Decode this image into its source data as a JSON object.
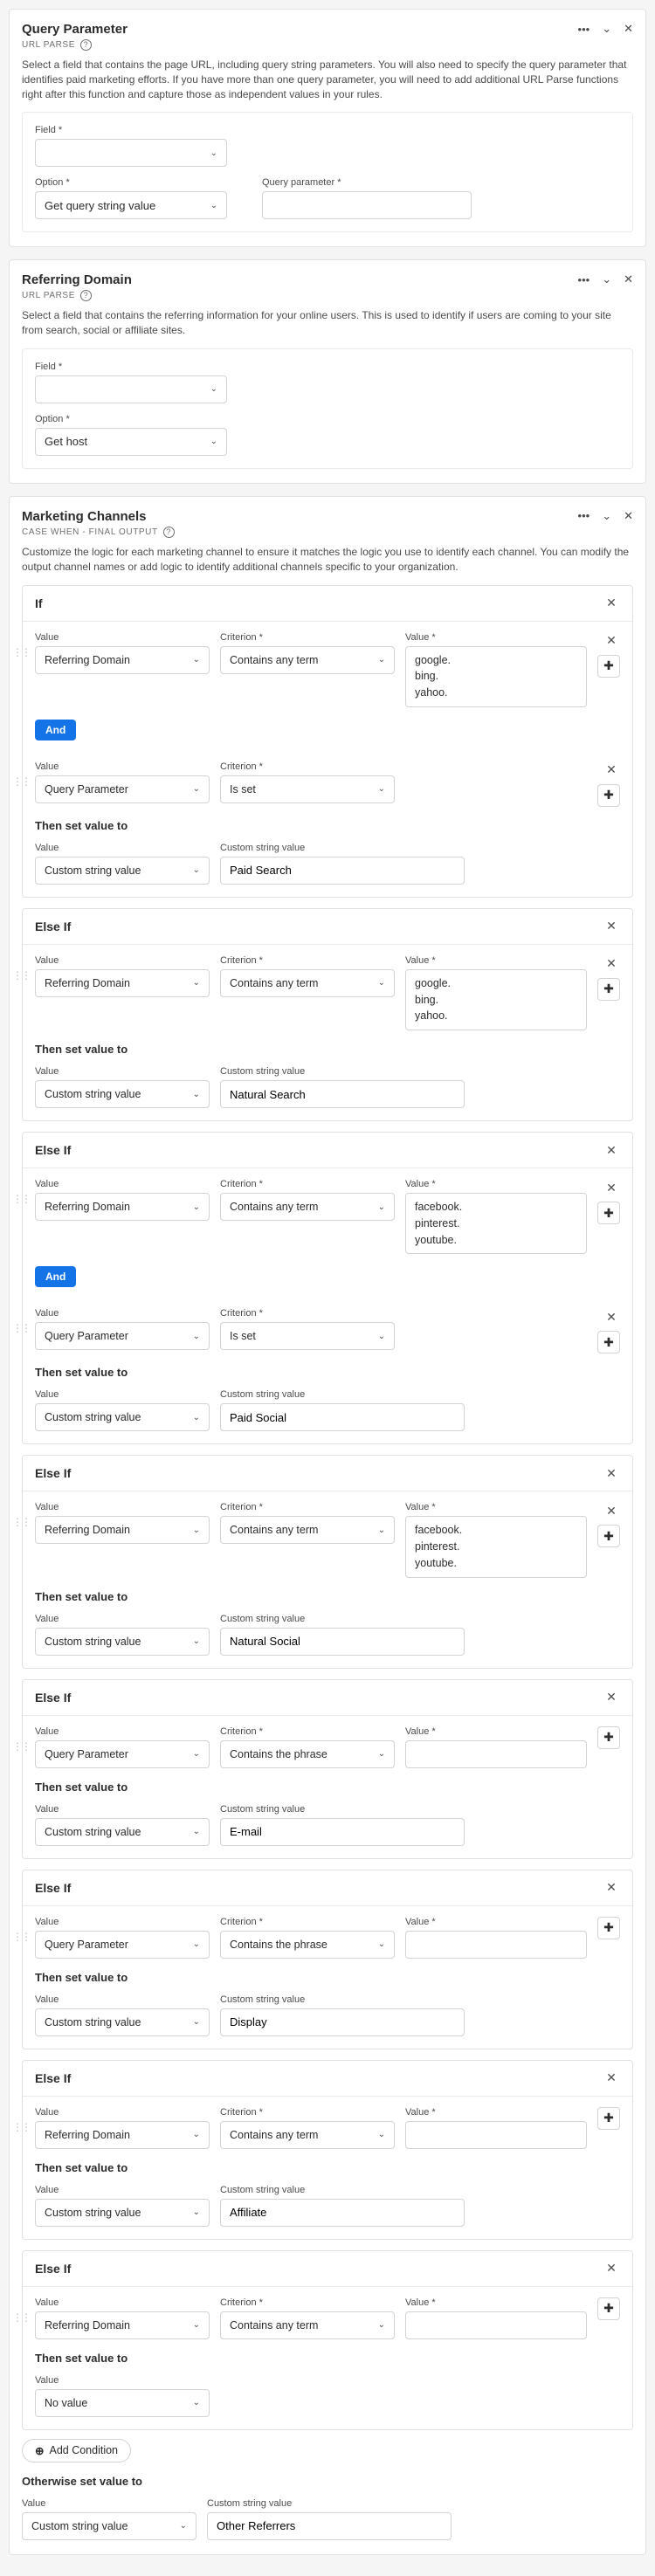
{
  "panels": {
    "query_parameter": {
      "title": "Query Parameter",
      "subtitle": "URL PARSE",
      "desc": "Select a field that contains the page URL, including query string parameters. You will also need to specify the query parameter that identifies paid marketing efforts. If you have more than one query parameter, you will need to add additional URL Parse functions right after this function and capture those as independent values in your rules.",
      "field_label": "Field",
      "option_label": "Option",
      "option_value": "Get query string value",
      "qp_label": "Query parameter"
    },
    "referring_domain": {
      "title": "Referring Domain",
      "subtitle": "URL PARSE",
      "desc": "Select a field that contains the referring information for your online users. This is used to identify if users are coming to your site from search, social or affiliate sites.",
      "field_label": "Field",
      "option_label": "Option",
      "option_value": "Get host"
    },
    "marketing_channels": {
      "title": "Marketing Channels",
      "subtitle": "CASE WHEN - FINAL OUTPUT",
      "desc": "Customize the logic for each marketing channel to ensure it matches the logic you use to identify each channel. You can modify the output channel names or add logic to identify additional channels specific to your organization."
    }
  },
  "labels": {
    "value": "Value",
    "criterion": "Criterion",
    "custom_string_value": "Custom string value",
    "then_set_value_to": "Then set value to",
    "otherwise_set_value_to": "Otherwise set value to",
    "and": "And",
    "add_condition": "Add Condition"
  },
  "options": {
    "referring_domain": "Referring Domain",
    "query_parameter": "Query Parameter",
    "contains_any_term": "Contains any term",
    "contains_the_phrase": "Contains the phrase",
    "is_set": "Is set",
    "custom_string_value": "Custom string value",
    "no_value": "No value"
  },
  "cases": [
    {
      "head": "If",
      "conditions": [
        {
          "value": "referring_domain",
          "criterion": "contains_any_term",
          "terms": "google.\nbing.\nyahoo.",
          "closable": true
        },
        {
          "value": "query_parameter",
          "criterion": "is_set",
          "terms": null,
          "closable": true,
          "and_before": true
        }
      ],
      "result": {
        "value_sel": "custom_string_value",
        "str": "Paid Search"
      }
    },
    {
      "head": "Else If",
      "conditions": [
        {
          "value": "referring_domain",
          "criterion": "contains_any_term",
          "terms": "google.\nbing.\nyahoo.",
          "closable": true
        }
      ],
      "result": {
        "value_sel": "custom_string_value",
        "str": "Natural Search"
      }
    },
    {
      "head": "Else If",
      "conditions": [
        {
          "value": "referring_domain",
          "criterion": "contains_any_term",
          "terms": "facebook.\npinterest.\nyoutube.",
          "closable": true
        },
        {
          "value": "query_parameter",
          "criterion": "is_set",
          "terms": null,
          "closable": true,
          "and_before": true
        }
      ],
      "result": {
        "value_sel": "custom_string_value",
        "str": "Paid Social"
      }
    },
    {
      "head": "Else If",
      "conditions": [
        {
          "value": "referring_domain",
          "criterion": "contains_any_term",
          "terms": "facebook.\npinterest.\nyoutube.",
          "closable": true
        }
      ],
      "result": {
        "value_sel": "custom_string_value",
        "str": "Natural Social"
      }
    },
    {
      "head": "Else If",
      "conditions": [
        {
          "value": "query_parameter",
          "criterion": "contains_the_phrase",
          "terms": "",
          "closable": false,
          "terms_small": true
        }
      ],
      "result": {
        "value_sel": "custom_string_value",
        "str": "E-mail"
      }
    },
    {
      "head": "Else If",
      "conditions": [
        {
          "value": "query_parameter",
          "criterion": "contains_the_phrase",
          "terms": "",
          "closable": false,
          "terms_small": true
        }
      ],
      "result": {
        "value_sel": "custom_string_value",
        "str": "Display"
      }
    },
    {
      "head": "Else If",
      "conditions": [
        {
          "value": "referring_domain",
          "criterion": "contains_any_term",
          "terms": "",
          "closable": false,
          "terms_small": true
        }
      ],
      "result": {
        "value_sel": "custom_string_value",
        "str": "Affiliate"
      }
    },
    {
      "head": "Else If",
      "conditions": [
        {
          "value": "referring_domain",
          "criterion": "contains_any_term",
          "terms": "",
          "closable": false,
          "terms_small": true
        }
      ],
      "result": {
        "value_sel": "no_value",
        "str": null
      }
    }
  ],
  "otherwise": {
    "value_sel": "custom_string_value",
    "str": "Other Referrers"
  }
}
